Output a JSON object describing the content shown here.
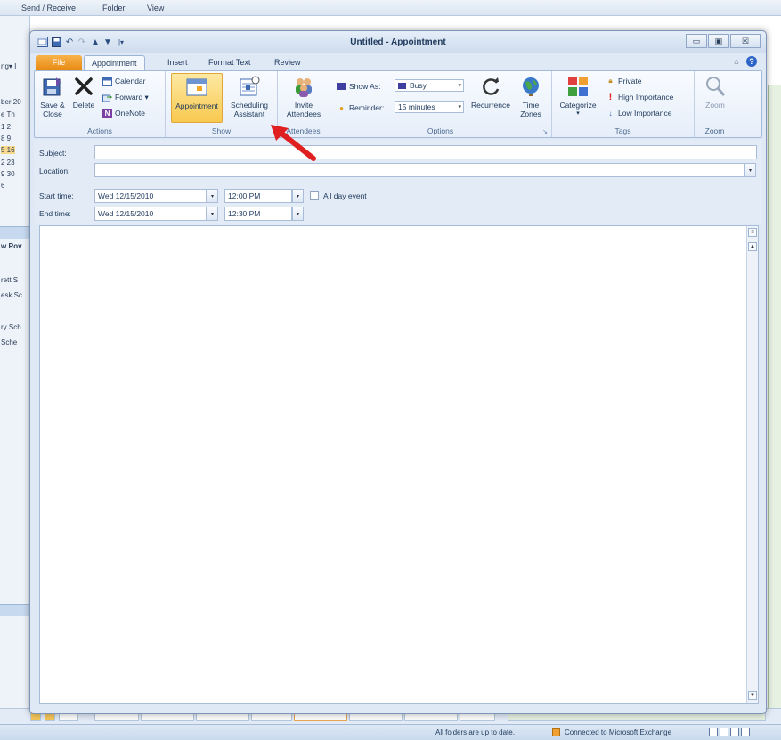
{
  "background": {
    "menu": [
      "Send / Receive",
      "Folder",
      "View"
    ],
    "left_fragments": [
      "ng▾ I",
      "ber 20",
      "e Th",
      "1  2",
      "8  9",
      "5 16",
      "2 23",
      "9 30",
      "6",
      "w Rov",
      "rett S",
      "esk Sc",
      "ry Sch",
      "Sche"
    ],
    "status_left": "All folders are up to date.",
    "status_right": "Connected to Microsoft Exchange"
  },
  "window": {
    "title": "Untitled - Appointment",
    "minimize": "▭",
    "restore": "▣",
    "close": "☒"
  },
  "tabs": [
    {
      "label": "File"
    },
    {
      "label": "Appointment"
    },
    {
      "label": "Insert"
    },
    {
      "label": "Format Text"
    },
    {
      "label": "Review"
    }
  ],
  "ribbon": {
    "actions": {
      "label": "Actions",
      "save_close": "Save &\nClose",
      "delete": "Delete",
      "calendar": "Calendar",
      "forward": "Forward ▾",
      "onenote": "OneNote"
    },
    "show": {
      "label": "Show",
      "appointment": "Appointment",
      "scheduling": "Scheduling\nAssistant"
    },
    "attendees": {
      "label": "Attendees",
      "invite": "Invite\nAttendees"
    },
    "options": {
      "label": "Options",
      "show_as_label": "Show As:",
      "show_as_value": "Busy",
      "reminder_label": "Reminder:",
      "reminder_value": "15 minutes",
      "recurrence": "Recurrence",
      "time_zones": "Time\nZones"
    },
    "tags": {
      "label": "Tags",
      "categorize": "Categorize",
      "private": "Private",
      "high": "High Importance",
      "low": "Low Importance"
    },
    "zoom": {
      "label": "Zoom",
      "zoom": "Zoom"
    }
  },
  "form": {
    "subject_label": "Subject:",
    "subject_value": "",
    "location_label": "Location:",
    "location_value": "",
    "start_label": "Start time:",
    "start_date": "Wed 12/15/2010",
    "start_time": "12:00 PM",
    "end_label": "End time:",
    "end_date": "Wed 12/15/2010",
    "end_time": "12:30 PM",
    "all_day": "All day event"
  },
  "colors": {
    "annotation_arrow": "#e02020",
    "file_tab": "#ee9520",
    "selected_button": "#f8c94f"
  }
}
